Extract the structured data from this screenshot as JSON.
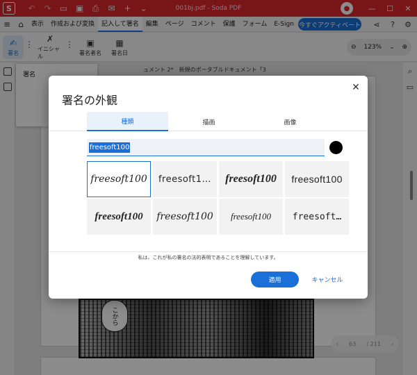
{
  "titlebar": {
    "title": "001bj.pdf - Soda PDF",
    "logo": "S",
    "icons": [
      "undo-icon",
      "redo-icon",
      "open-folder-icon",
      "save-icon",
      "print-icon",
      "mail-icon",
      "plus-icon",
      "chevron-down-icon"
    ],
    "accent": "#d9272e"
  },
  "menubar": {
    "items": [
      "表示",
      "作成および変換",
      "記入して署名",
      "編集",
      "ページ",
      "コメント",
      "保護",
      "フォーム",
      "E-Sign"
    ],
    "active_index": 2,
    "activate_label": "今すぐアクティベート"
  },
  "ribbon": {
    "signature_label": "署名",
    "initials_label": "イニシャル",
    "signer_name_label": "署名者名",
    "sign_date_label": "署名日",
    "zoom": "123%"
  },
  "workspace": {
    "doc_tabs_text": "ュメント 2*　新規のポータブルドキュメント「3",
    "sig_panel_title": "署名",
    "bubble_text": "こから",
    "page_indicator": {
      "current": "63",
      "total": "/ 211"
    }
  },
  "dialog": {
    "title": "署名の外観",
    "tabs": [
      "種類",
      "描画",
      "画像"
    ],
    "active_tab": 0,
    "input_value": "freesoft100",
    "color": "#000000",
    "styles": [
      {
        "text": "freesoft100",
        "selected": true
      },
      {
        "text": "freesoft1…",
        "selected": false
      },
      {
        "text": "freesoft100",
        "selected": false
      },
      {
        "text": "freesoft100",
        "selected": false
      },
      {
        "text": "freesoft100",
        "selected": false
      },
      {
        "text": "freesoft100",
        "selected": false
      },
      {
        "text": "freesoft100",
        "selected": false
      },
      {
        "text": "freesoft…",
        "selected": false
      }
    ],
    "legal_text": "私は、これが私の署名の法的表明であることを理解しています。",
    "apply_label": "適用",
    "cancel_label": "キャンセル"
  }
}
